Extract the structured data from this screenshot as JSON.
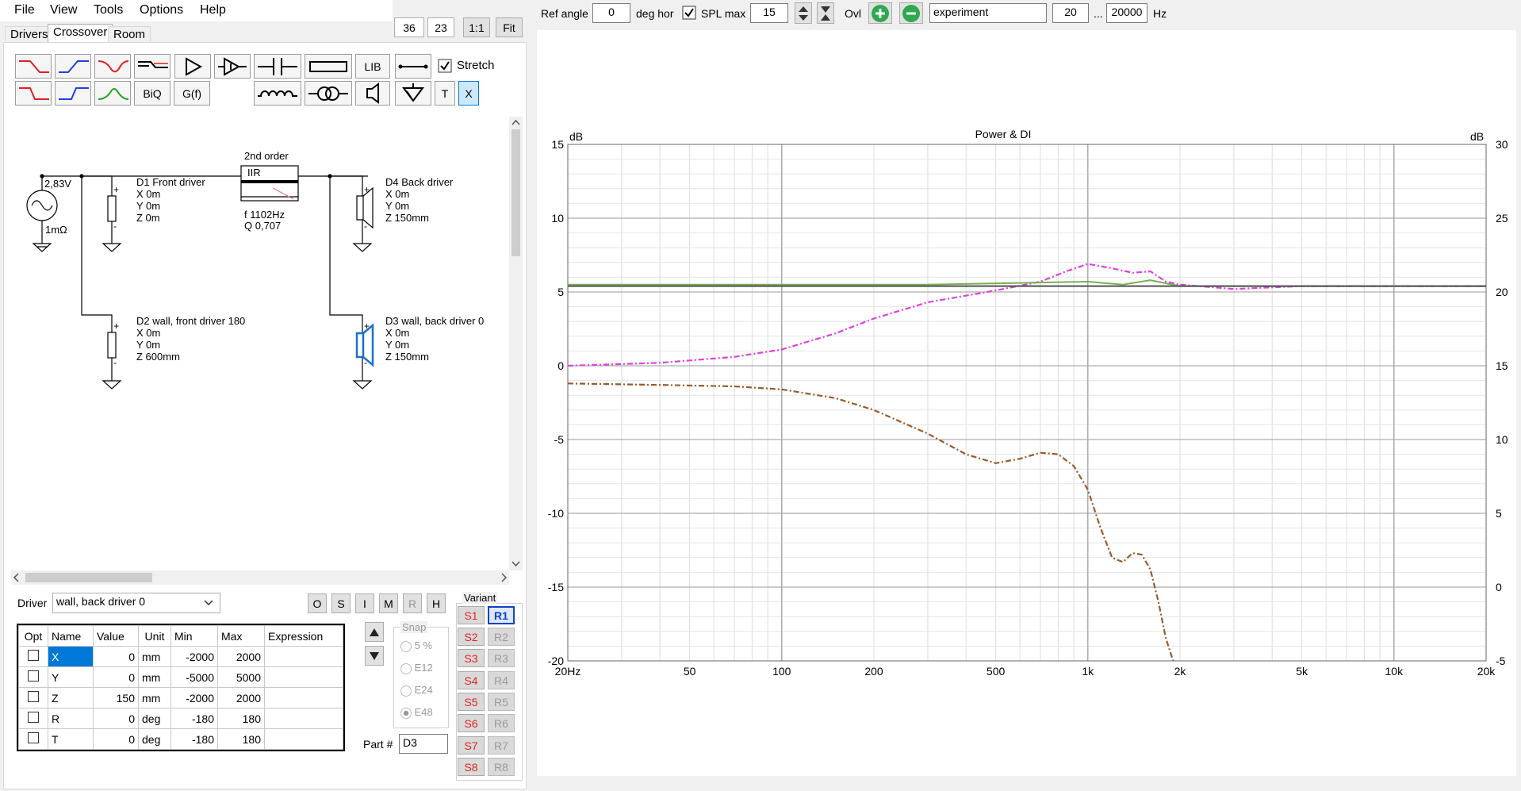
{
  "menu": [
    "File",
    "View",
    "Tools",
    "Options",
    "Help"
  ],
  "zoom": {
    "a": "36",
    "b": "23",
    "one": "1:1",
    "fit": "Fit"
  },
  "tabs": [
    "Drivers",
    "Crossover",
    "Room"
  ],
  "toolbar": {
    "lib": "LIB",
    "biq": "BiQ",
    "gf": "G(f)",
    "t": "T",
    "x": "X",
    "stretch": "Stretch"
  },
  "schematic": {
    "source_voltage": "2,83V",
    "source_impedance": "1mΩ",
    "filter_title": "2nd order",
    "filter_type": "IIR",
    "filter_f": "f   1102Hz",
    "filter_q": "Q  0,707",
    "drivers": [
      {
        "name": "D1 Front driver",
        "x": "X 0m",
        "y": "Y 0m",
        "z": "Z 0m"
      },
      {
        "name": "D2 wall, front driver 180",
        "x": "X 0m",
        "y": "Y 0m",
        "z": "Z 600mm"
      },
      {
        "name": "D4 Back driver",
        "x": "X 0m",
        "y": "Y 0m",
        "z": "Z 150mm"
      },
      {
        "name": "D3 wall, back driver 0",
        "x": "X 0m",
        "y": "Y 0m",
        "z": "Z 150mm"
      }
    ]
  },
  "driver_select": {
    "label": "Driver",
    "value": "wall, back driver 0"
  },
  "mode_buttons": [
    "O",
    "S",
    "I",
    "M",
    "R",
    "H"
  ],
  "params": {
    "headers": [
      "Opt",
      "Name",
      "Value",
      "Unit",
      "Min",
      "Max",
      "Expression"
    ],
    "rows": [
      {
        "name": "X",
        "value": "0",
        "unit": "mm",
        "min": "-2000",
        "max": "2000",
        "expr": ""
      },
      {
        "name": "Y",
        "value": "0",
        "unit": "mm",
        "min": "-5000",
        "max": "5000",
        "expr": ""
      },
      {
        "name": "Z",
        "value": "150",
        "unit": "mm",
        "min": "-2000",
        "max": "2000",
        "expr": ""
      },
      {
        "name": "R",
        "value": "0",
        "unit": "deg",
        "min": "-180",
        "max": "180",
        "expr": ""
      },
      {
        "name": "T",
        "value": "0",
        "unit": "deg",
        "min": "-180",
        "max": "180",
        "expr": ""
      }
    ]
  },
  "snap": {
    "title": "Snap",
    "options": [
      "5 %",
      "E12",
      "E24",
      "E48"
    ],
    "selected": "E48"
  },
  "part": {
    "label": "Part #",
    "value": "D3"
  },
  "variant": {
    "title": "Variant",
    "s": [
      "S1",
      "S2",
      "S3",
      "S4",
      "S5",
      "S6",
      "S7",
      "S8"
    ],
    "r": [
      "R1",
      "R2",
      "R3",
      "R4",
      "R5",
      "R6",
      "R7",
      "R8"
    ],
    "active_r": "R1"
  },
  "topbar": {
    "ref_angle_label": "Ref angle",
    "ref_angle": "0",
    "deg_hor": "deg hor",
    "spl_max_label": "SPL max",
    "spl_max": "15",
    "ovl": "Ovl",
    "name": "experiment",
    "f_from": "20",
    "dots": "...",
    "f_to": "20000",
    "hz": "Hz"
  },
  "chart_data": {
    "type": "line",
    "title": "Power & DI",
    "ylabel_left": "dB",
    "ylabel_right": "dB",
    "xscale": "log",
    "xlim": [
      20,
      20000
    ],
    "ylim_left": [
      -20,
      15
    ],
    "ylim_right": [
      -5,
      30
    ],
    "xticks": [
      20,
      50,
      100,
      200,
      500,
      1000,
      2000,
      5000,
      10000,
      20000
    ],
    "xtick_labels": [
      "20Hz",
      "50",
      "100",
      "200",
      "500",
      "1k",
      "2k",
      "5k",
      "10k",
      "20k"
    ],
    "yticks_left": [
      -20,
      -15,
      -10,
      -5,
      0,
      5,
      10,
      15
    ],
    "yticks_right": [
      -5,
      0,
      5,
      10,
      15,
      20,
      25,
      30
    ],
    "grid": true,
    "colors": {
      "magenta": "#e040e0",
      "brown": "#9a5a2a",
      "green": "#7ab050",
      "dark": "#505050"
    },
    "series": [
      {
        "color": "#e040e0",
        "style": "dashdot",
        "axis": "left",
        "x": [
          20,
          40,
          70,
          100,
          150,
          200,
          300,
          500,
          700,
          850,
          1000,
          1200,
          1400,
          1600,
          1800,
          2000,
          3000,
          5000,
          20000
        ],
        "y": [
          0,
          0.2,
          0.6,
          1.1,
          2.2,
          3.2,
          4.3,
          5.1,
          5.7,
          6.4,
          6.9,
          6.6,
          6.3,
          6.4,
          5.7,
          5.5,
          5.2,
          5.4,
          5.4
        ]
      },
      {
        "color": "#9a5a2a",
        "style": "dashdot",
        "axis": "left",
        "x": [
          20,
          40,
          70,
          100,
          150,
          200,
          300,
          400,
          500,
          600,
          700,
          800,
          900,
          1000,
          1100,
          1200,
          1300,
          1400,
          1500,
          1600,
          1700,
          1800,
          1900
        ],
        "y": [
          -1.2,
          -1.3,
          -1.4,
          -1.6,
          -2.2,
          -3.0,
          -4.6,
          -6.0,
          -6.6,
          -6.3,
          -5.9,
          -6.0,
          -6.8,
          -8.4,
          -11.0,
          -13.0,
          -13.3,
          -12.7,
          -12.8,
          -13.8,
          -16.0,
          -18.5,
          -20
        ]
      },
      {
        "color": "#7ab050",
        "style": "solid",
        "axis": "left",
        "x": [
          20,
          300,
          1000,
          1300,
          1600,
          2000,
          3000,
          20000
        ],
        "y": [
          5.5,
          5.5,
          5.7,
          5.5,
          5.8,
          5.4,
          5.4,
          5.4
        ]
      },
      {
        "color": "#505050",
        "style": "solid",
        "axis": "left",
        "x": [
          20,
          20000
        ],
        "y": [
          5.4,
          5.4
        ]
      }
    ]
  }
}
